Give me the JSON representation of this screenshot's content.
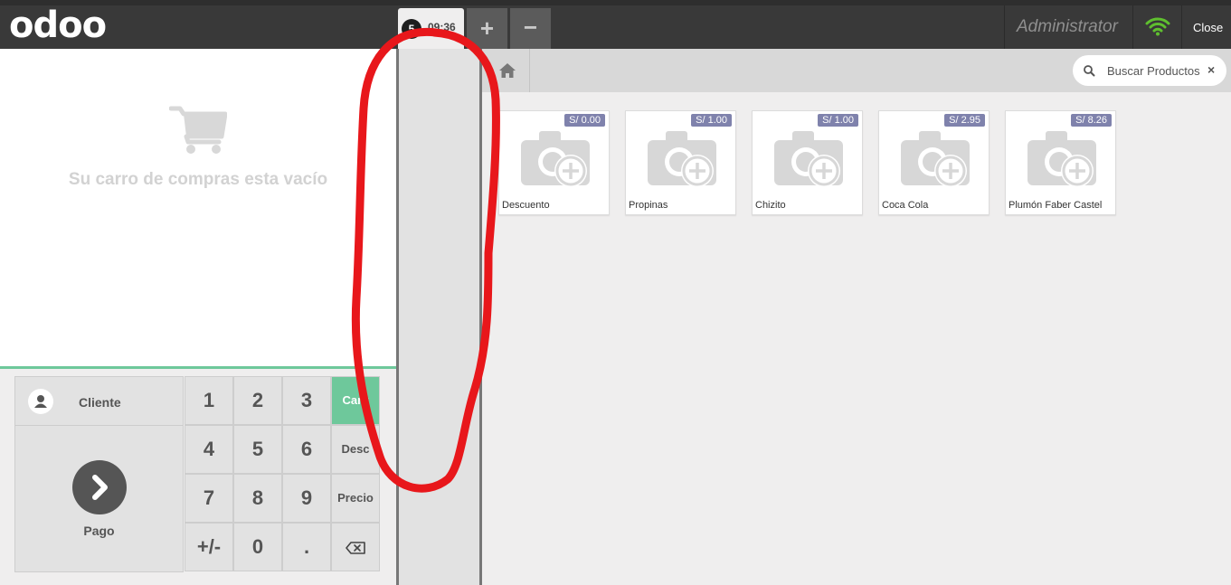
{
  "header": {
    "logo": "odoo",
    "order_tab": {
      "badge": "5",
      "time": "09:36"
    },
    "new_order_label": "+",
    "delete_order_label": "−",
    "username": "Administrator",
    "close_label": "Close"
  },
  "cart": {
    "empty_message": "Su carro de compras esta vacío"
  },
  "actionpad": {
    "customer_label": "Cliente",
    "payment_label": "Pago"
  },
  "numpad": {
    "keys": [
      "1",
      "2",
      "3",
      "4",
      "5",
      "6",
      "7",
      "8",
      "9",
      "+/-",
      "0",
      "."
    ],
    "modes": [
      "Cant",
      "Desc",
      "Precio"
    ],
    "active_mode": "Cant"
  },
  "search": {
    "placeholder": "Buscar Productos",
    "clear_icon": "×"
  },
  "products": [
    {
      "name": "Descuento",
      "price": "S/ 0.00"
    },
    {
      "name": "Propinas",
      "price": "S/ 1.00"
    },
    {
      "name": "Chizito",
      "price": "S/ 1.00"
    },
    {
      "name": "Coca Cola",
      "price": "S/ 2.95"
    },
    {
      "name": "Plumón Faber Castel",
      "price": "S/ 8.26"
    }
  ],
  "colors": {
    "accent": "#6ec89b",
    "price_tag": "#7f82ac",
    "topbar": "#393939",
    "annotation": "#e8171b",
    "wifi": "#5fbf2f"
  }
}
